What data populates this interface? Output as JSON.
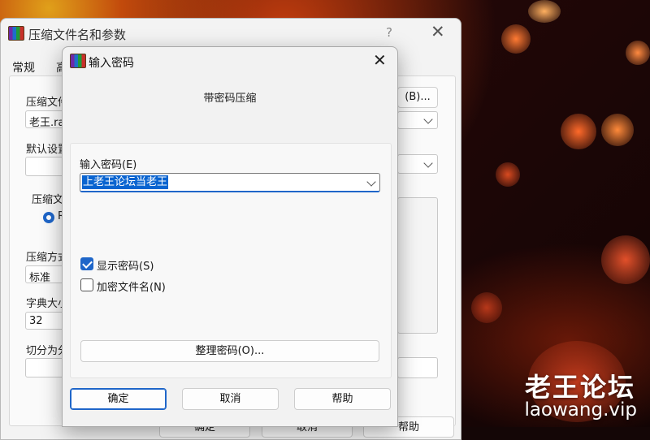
{
  "background_dialog": {
    "title": "压缩文件名和参数",
    "help_glyph": "?",
    "close_glyph": "✕",
    "tab_general": "常规",
    "tab_advanced_partial": "高",
    "archive_name_label": "压缩文件",
    "archive_name_value": "老王.ra",
    "browse_button": "(B)...",
    "default_profile_label": "默认设置",
    "archive_format_label": "压缩文",
    "format_radio_partial": "R",
    "method_label": "压缩方式",
    "method_value": "标准",
    "dictionary_label": "字典大小",
    "dictionary_value": "32",
    "split_label": "切分为分卷",
    "ok_button": "确定",
    "cancel_button": "取消",
    "help_button": "帮助"
  },
  "password_dialog": {
    "title": "输入密码",
    "close_glyph": "✕",
    "subtitle": "带密码压缩",
    "password_label": "输入密码(E)",
    "password_value": "上老王论坛当老王",
    "show_password": {
      "label": "显示密码(S)",
      "checked": true
    },
    "encrypt_filenames": {
      "label": "加密文件名(N)",
      "checked": false
    },
    "organize_button": "整理密码(O)...",
    "ok_button": "确定",
    "cancel_button": "取消",
    "help_button": "帮助"
  },
  "watermark": {
    "name": "老王论坛",
    "url": "laowang.vip"
  }
}
